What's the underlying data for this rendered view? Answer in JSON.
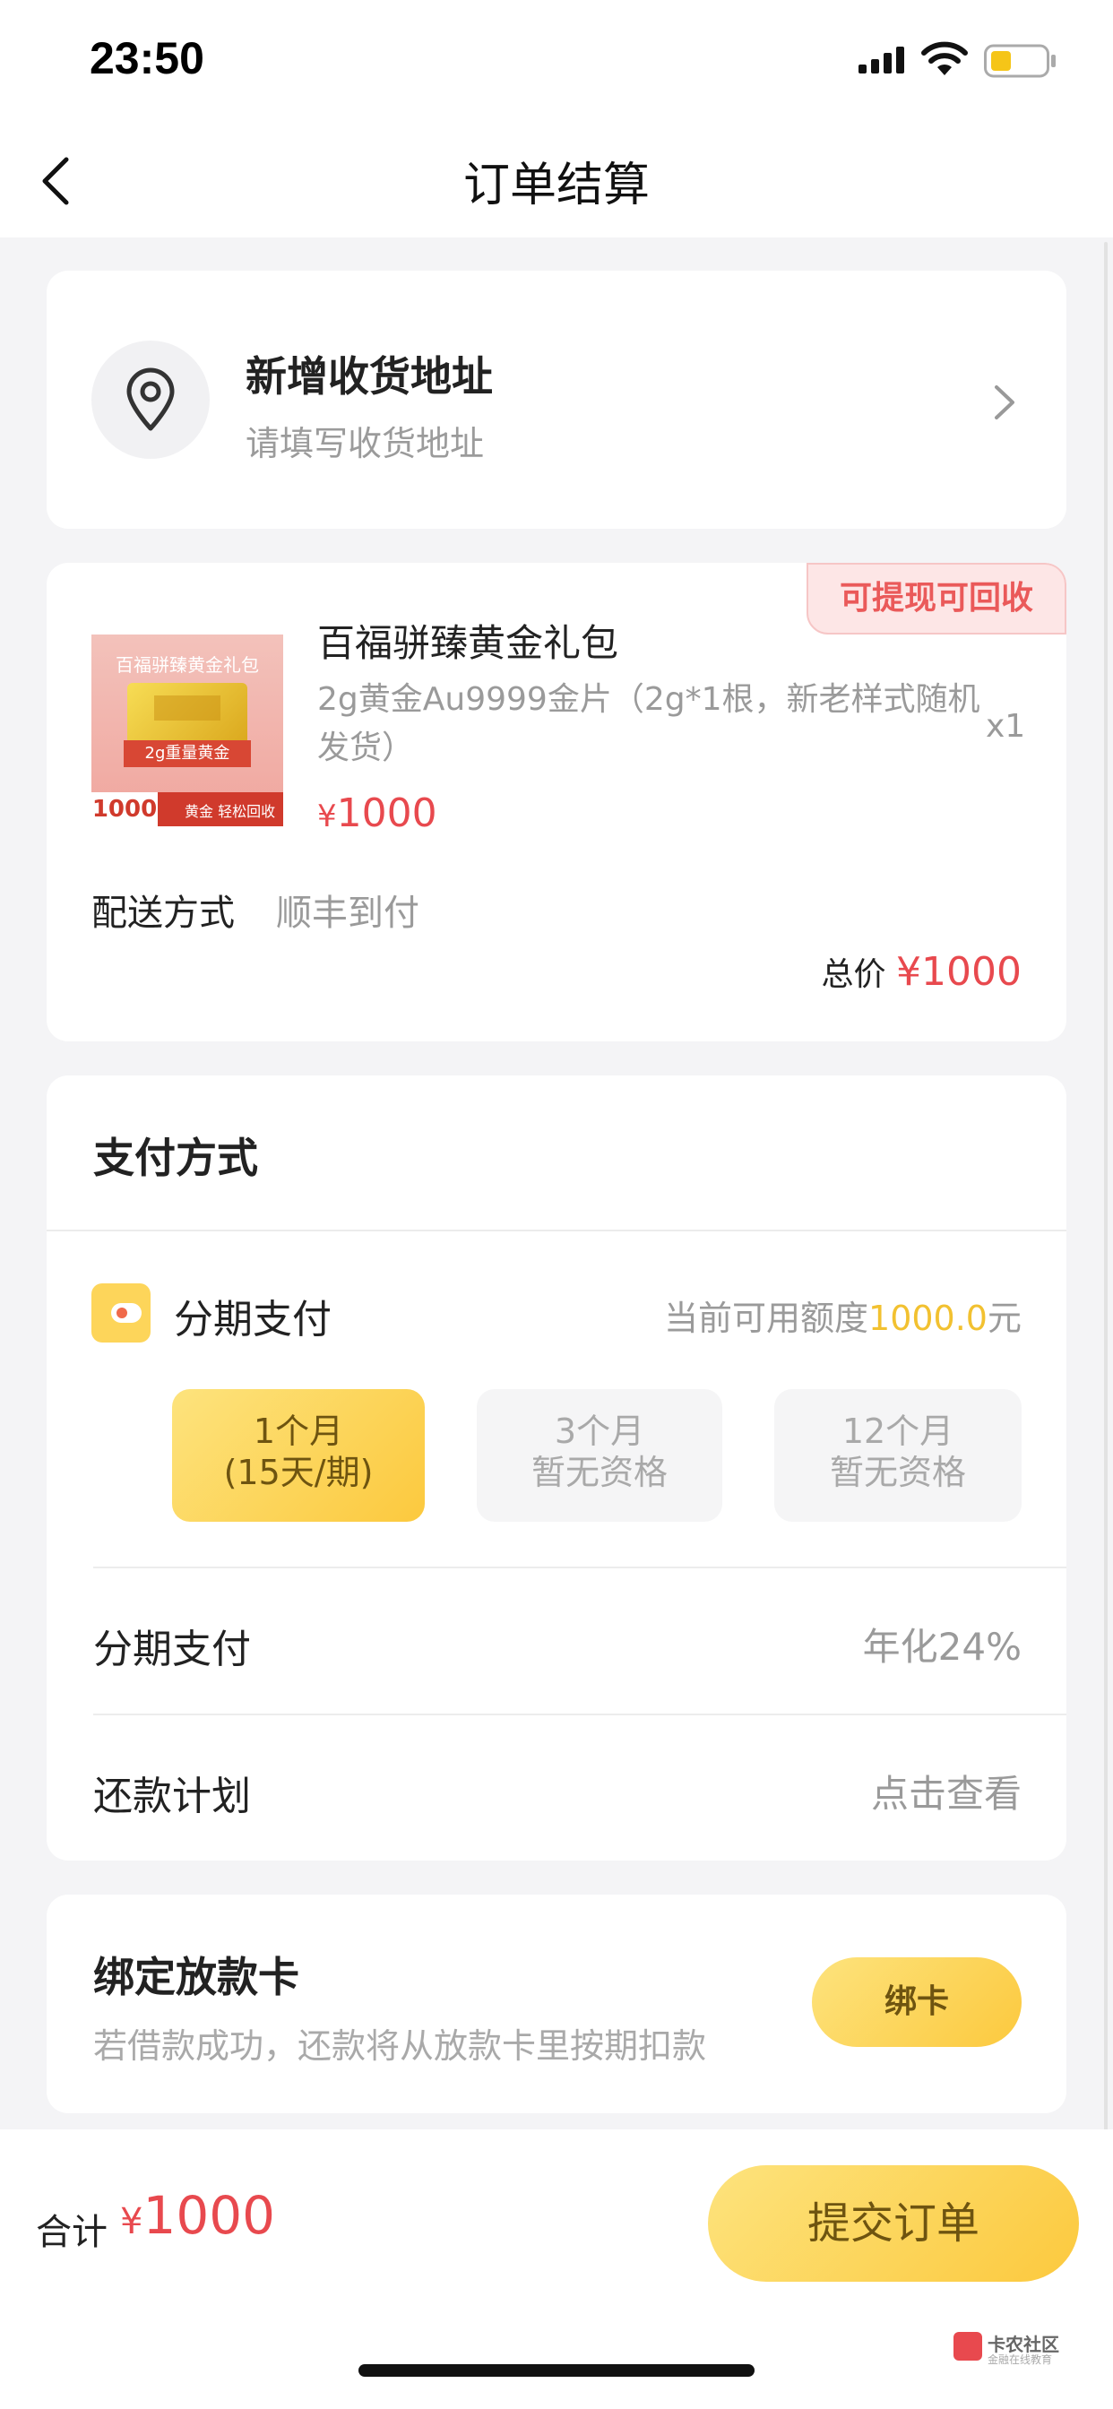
{
  "status_bar": {
    "time": "23:50"
  },
  "nav": {
    "title": "订单结算"
  },
  "address": {
    "title": "新增收货地址",
    "subtitle": "请填写收货地址"
  },
  "product": {
    "badge": "可提现可回收",
    "name": "百福骈臻黄金礼包",
    "description": "2g黄金Au9999金片（2g*1根，新老样式随机发货）",
    "quantity": "x1",
    "price_currency": "¥",
    "price": "1000",
    "image": {
      "title": "百福骈臻黄金礼包",
      "weight": "2g重量黄金",
      "number": "1000",
      "tag": "黄金 轻松回收"
    },
    "shipping_label": "配送方式",
    "shipping_value": "顺丰到付",
    "total_label": "总价",
    "total_amount": "¥1000"
  },
  "payment": {
    "title": "支付方式",
    "installment_label": "分期支付",
    "credit_prefix": "当前可用额度",
    "credit_amount": "1000.0",
    "credit_suffix": "元",
    "terms": [
      {
        "line1": "1个月",
        "line2": "(15天/期)",
        "active": true
      },
      {
        "line1": "3个月",
        "line2": "暂无资格",
        "active": false
      },
      {
        "line1": "12个月",
        "line2": "暂无资格",
        "active": false
      }
    ],
    "rows": [
      {
        "label": "分期支付",
        "value": "年化24%"
      },
      {
        "label": "还款计划",
        "value": "点击查看"
      }
    ]
  },
  "bind_card": {
    "title": "绑定放款卡",
    "subtitle": "若借款成功，还款将从放款卡里按期扣款",
    "button": "绑卡"
  },
  "footer": {
    "sum_label": "合计",
    "sum_currency": "¥",
    "sum_amount": "1000",
    "submit": "提交订单",
    "watermark": "卡农社区",
    "watermark_sub": "金融在线教育"
  },
  "colors": {
    "accent": "#fcc93e",
    "price": "#e8494e",
    "badge_bg": "#fde6e6"
  }
}
